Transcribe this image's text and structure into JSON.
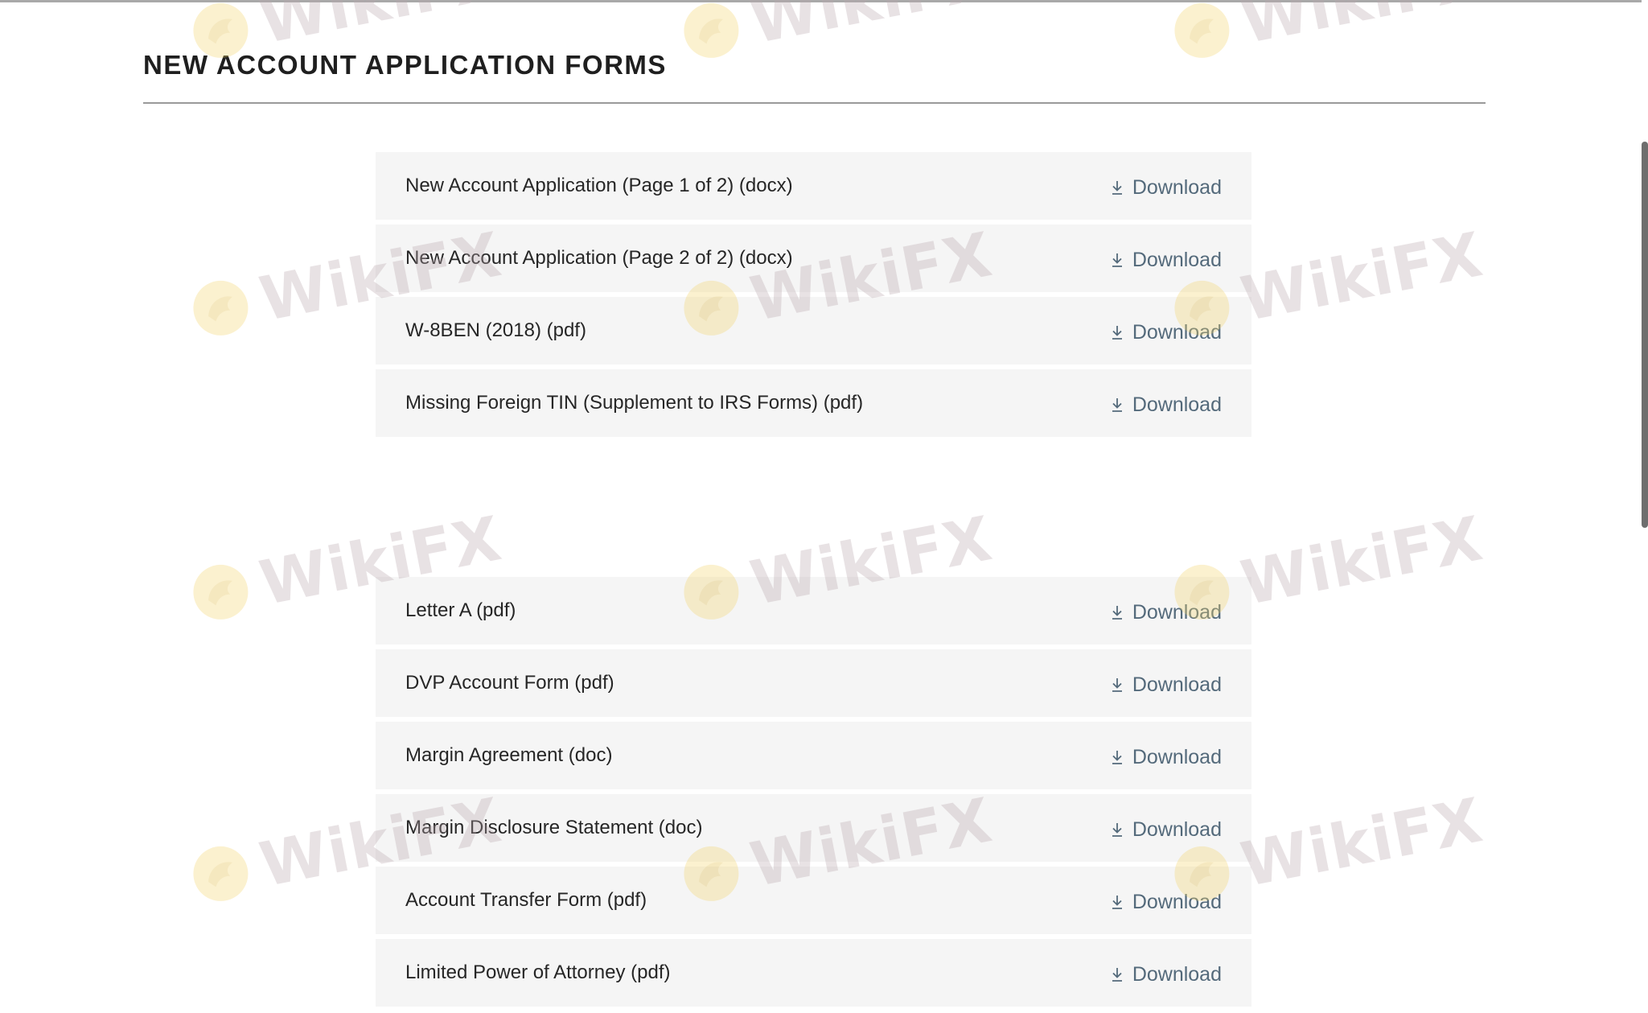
{
  "page": {
    "title": "NEW ACCOUNT APPLICATION FORMS"
  },
  "download_label": "Download",
  "groups": [
    {
      "forms": [
        {
          "name": "New Account Application (Page 1 of 2) (docx)",
          "action": "Download"
        },
        {
          "name": "New Account Application (Page 2 of 2) (docx)",
          "action": "Download"
        },
        {
          "name": "W-8BEN (2018) (pdf)",
          "action": "Download"
        },
        {
          "name": "Missing Foreign TIN (Supplement to IRS Forms) (pdf)",
          "action": "Download"
        }
      ]
    },
    {
      "forms": [
        {
          "name": "Letter A (pdf)",
          "action": "Download"
        },
        {
          "name": "DVP Account Form (pdf)",
          "action": "Download"
        },
        {
          "name": "Margin Agreement (doc)",
          "action": "Download"
        },
        {
          "name": "Margin Disclosure Statement (doc)",
          "action": "Download"
        },
        {
          "name": "Account Transfer Form (pdf)",
          "action": "Download"
        },
        {
          "name": "Limited Power of Attorney (pdf)",
          "action": "Download"
        }
      ]
    }
  ],
  "icons": {
    "download": "download-icon",
    "watermark_logo": "wikifx-logo-icon"
  },
  "watermark": {
    "text": "WikiFX"
  },
  "colors": {
    "row_background": "#f5f5f5",
    "link": "#546a7b",
    "title": "#1f1f1f",
    "divider": "#9a9a9a"
  }
}
